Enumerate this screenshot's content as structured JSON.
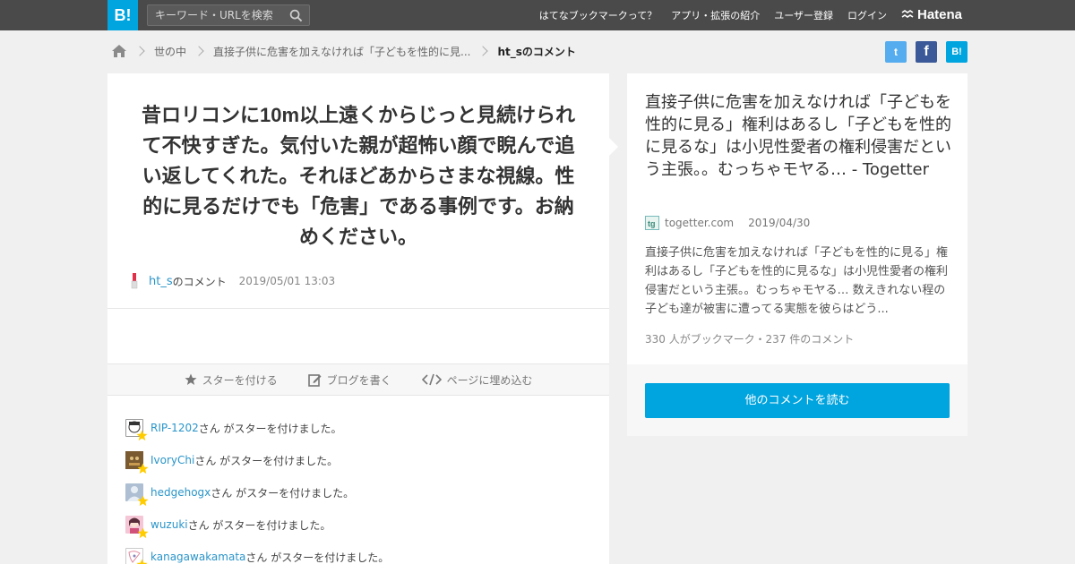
{
  "header": {
    "logo_text": "B!",
    "search_placeholder": "キーワード・URLを検索",
    "nav": [
      "はてなブックマークって？",
      "アプリ・拡張の紹介",
      "ユーザー登録",
      "ログイン"
    ],
    "brand": "Hatena"
  },
  "breadcrumb": {
    "items": [
      "世の中",
      "直接子供に危害を加えなければ「子どもを性的に見..."
    ],
    "current": "ht_sのコメント"
  },
  "share": {
    "twitter": "t",
    "facebook": "f",
    "hatebu": "B!"
  },
  "comment": {
    "text": "昔ロリコンに10m以上遠くからじっと見続けられて不快すぎた。気付いた親が超怖い顔で睨んで追い返してくれた。それほどあからさまな視線。性的に見るだけでも「危害」である事例です。お納めください。",
    "user": "ht_s",
    "user_suffix": "のコメント",
    "date": "2019/05/01 13:03"
  },
  "actions": {
    "star": "スターを付ける",
    "blog": "ブログを書く",
    "embed": "ページに埋め込む"
  },
  "stars": {
    "suffix": "さん がスターを付けました。",
    "users": [
      "RIP-1202",
      "IvoryChi",
      "hedgehogx",
      "wuzuki",
      "kanagawakamata"
    ]
  },
  "entry": {
    "title": "直接子供に危害を加えなければ「子どもを性的に見る」権利はあるし「子どもを性的に見るな」は小児性愛者の権利侵害だという主張。。むっちゃモヤる… - Togetter",
    "site": "togetter.com",
    "date": "2019/04/30",
    "description": "直接子供に危害を加えなければ「子どもを性的に見る」権利はあるし「子どもを性的に見るな」は小児性愛者の権利侵害だという主張。。むっちゃモヤる… 数えきれない程の子ども達が被害に遭ってる実態を彼らはどう...",
    "count": "330 人がブックマーク・237 件のコメント",
    "read_more": "他のコメントを読む"
  },
  "colors": {
    "topbar": "#4a4a4a",
    "accent": "#00a4de",
    "link": "#2a95c9",
    "star": "#ffcc00"
  }
}
